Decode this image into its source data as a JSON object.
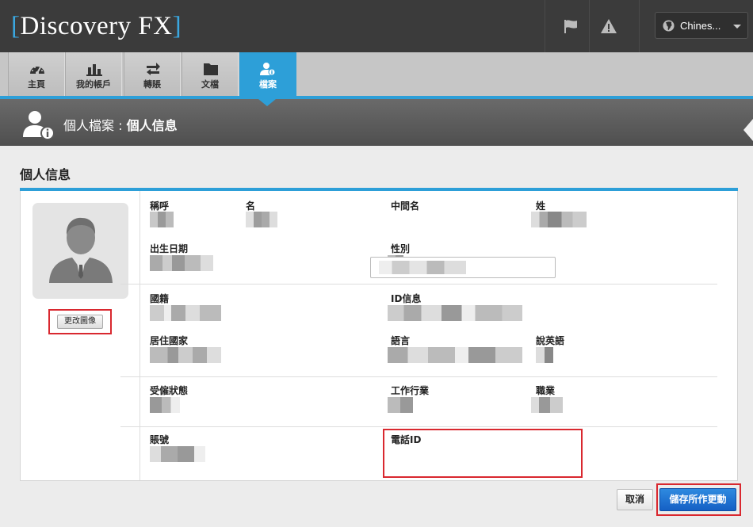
{
  "header": {
    "logo_open": "[",
    "logo_text": "Discovery FX",
    "logo_close": "]",
    "flag_icon": "flag-icon",
    "warning_icon": "warning-icon",
    "language": "Chines..."
  },
  "nav": {
    "tabs": [
      {
        "label": "主頁",
        "icon": "dashboard-icon"
      },
      {
        "label": "我的帳戶",
        "icon": "bar-chart-icon"
      },
      {
        "label": "轉賬",
        "icon": "transfer-icon"
      },
      {
        "label": "文檔",
        "icon": "folder-icon"
      },
      {
        "label": "檔案",
        "icon": "user-info-icon",
        "active": true
      }
    ]
  },
  "titlebar": {
    "section": "個人檔案 : ",
    "page": "個人信息"
  },
  "profile": {
    "title": "個人信息",
    "change_image_label": "更改圖像",
    "fields": {
      "salutation": "稱呼",
      "first_name": "名",
      "middle_name": "中間名",
      "last_name": "姓",
      "dob": "出生日期",
      "gender": "性別",
      "nationality": "國籍",
      "id_info": "ID信息",
      "country": "居住國家",
      "language": "語言",
      "speaks_english": "說英語",
      "employment_status": "受僱狀態",
      "industry": "工作行業",
      "occupation": "職業",
      "account": "賬號",
      "phone_id": "電話ID"
    }
  },
  "actions": {
    "cancel": "取消",
    "save": "儲存所作更動"
  },
  "colors": {
    "accent": "#2d9fd8",
    "header": "#3b3b3b",
    "save": "#1a6fd2",
    "highlight": "#d9282f"
  }
}
